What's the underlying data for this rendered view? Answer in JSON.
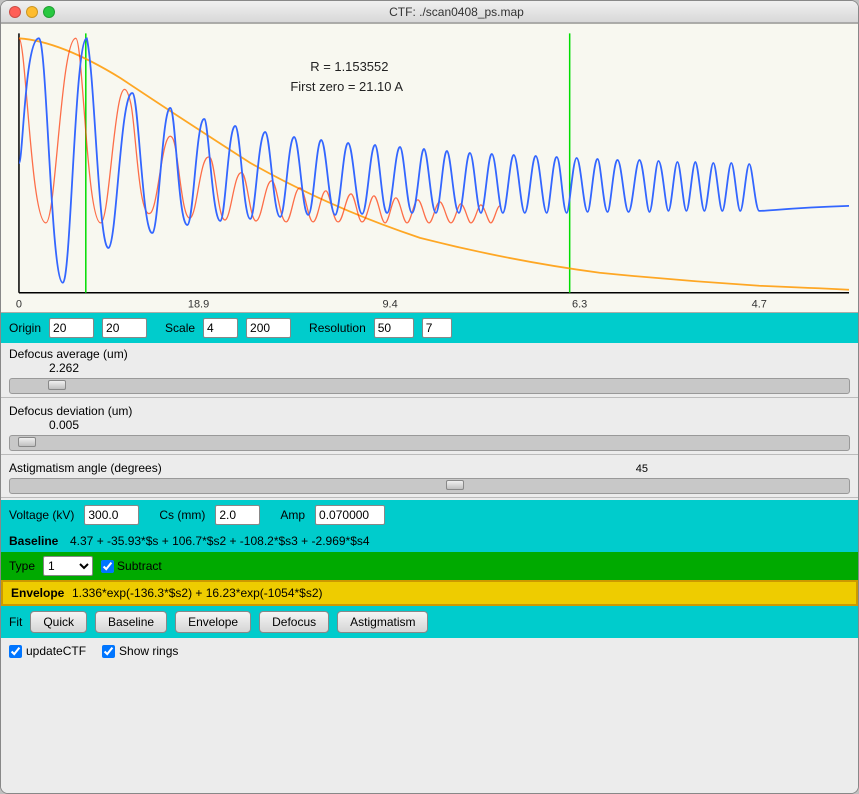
{
  "window": {
    "title": "CTF: ./scan0408_ps.map"
  },
  "plot": {
    "r_label": "R  =  1.153552",
    "first_zero_label": "First zero =    21.10 A",
    "x_labels": [
      "0",
      "18.9",
      "9.4",
      "6.3",
      "4.7"
    ]
  },
  "origin_row": {
    "label": "Origin",
    "val1": "20",
    "val2": "20",
    "scale_label": "Scale",
    "scale1": "4",
    "scale2": "200",
    "resolution_label": "Resolution",
    "res1": "50",
    "res2": "7"
  },
  "defocus_avg": {
    "label": "Defocus average (um)",
    "value": "2.262"
  },
  "defocus_dev": {
    "label": "Defocus deviation (um)",
    "value": "0.005"
  },
  "astigmatism": {
    "label": "Astigmatism angle (degrees)",
    "value": "45"
  },
  "voltage_row": {
    "voltage_label": "Voltage (kV)",
    "voltage_val": "300.0",
    "cs_label": "Cs (mm)",
    "cs_val": "2.0",
    "amp_label": "Amp",
    "amp_val": "0.070000"
  },
  "baseline": {
    "label": "Baseline",
    "formula": "4.37 + -35.93*$s + 106.7*$s2 + -108.2*$s3 + -2.969*$s4"
  },
  "type_row": {
    "label": "Type",
    "value": "1",
    "subtract_label": "Subtract",
    "subtract_checked": true
  },
  "envelope": {
    "label": "Envelope",
    "formula": "1.336*exp(-136.3*$s2) + 16.23*exp(-1054*$s2)"
  },
  "fit_row": {
    "label": "Fit",
    "buttons": [
      "Quick",
      "Baseline",
      "Envelope",
      "Defocus",
      "Astigmatism"
    ]
  },
  "bottom_row": {
    "update_ctf_label": "updateCTF",
    "show_rings_label": "Show rings",
    "update_ctf_checked": true,
    "show_rings_checked": true
  }
}
